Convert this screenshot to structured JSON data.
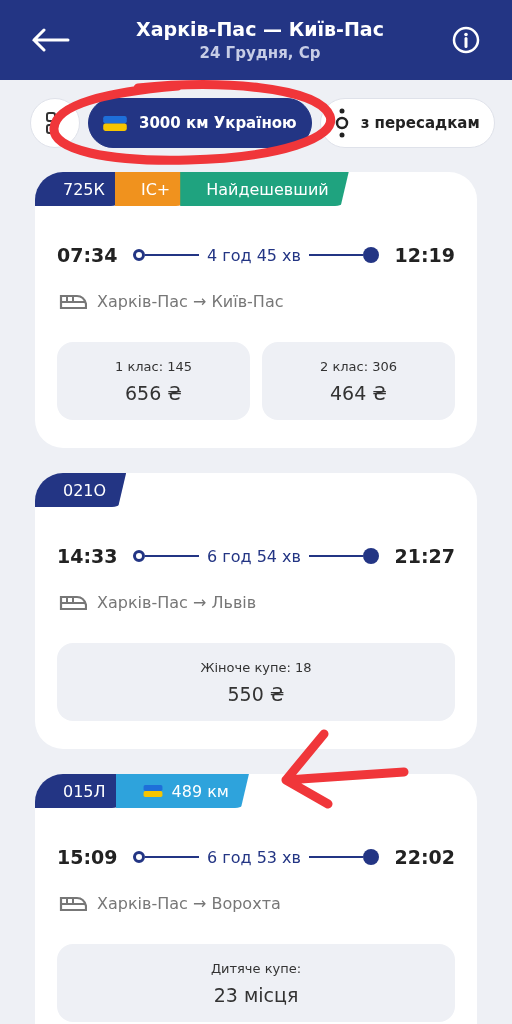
{
  "header": {
    "title": "Харків-Пас — Київ-Пас",
    "subtitle": "24 Грудня, Ср"
  },
  "chips": [
    {
      "kind": "icon",
      "selected": false
    },
    {
      "kind": "flag",
      "label": "3000 км Україною",
      "selected": true
    },
    {
      "kind": "transfer",
      "label": "з пересадкам",
      "selected": false
    }
  ],
  "trains": [
    {
      "tags": [
        {
          "kind": "plain",
          "label": "725К",
          "color": "#233584"
        },
        {
          "kind": "plain",
          "label": "IC+",
          "color": "#f0921e"
        },
        {
          "kind": "plain",
          "label": "Найдешевший",
          "color": "#1fa37f"
        }
      ],
      "departure": "07:34",
      "duration": "4 год 45 хв",
      "arrival": "12:19",
      "route": "Харків-Пас → Київ-Пас",
      "fares": [
        {
          "label": "1 клас: 145",
          "value": "656 ₴"
        },
        {
          "label": "2 клас: 306",
          "value": "464 ₴"
        }
      ]
    },
    {
      "tags": [
        {
          "kind": "plain",
          "label": "021О",
          "color": "#233584"
        }
      ],
      "departure": "14:33",
      "duration": "6 год 54 хв",
      "arrival": "21:27",
      "route": "Харків-Пас → Львів",
      "fares": [
        {
          "label": "Жіноче купе: 18",
          "value": "550 ₴"
        }
      ]
    },
    {
      "tags": [
        {
          "kind": "plain",
          "label": "015Л",
          "color": "#233584"
        },
        {
          "kind": "flag",
          "label": "489 км",
          "color": "#2ea3dc"
        }
      ],
      "departure": "15:09",
      "duration": "6 год 53 хв",
      "arrival": "22:02",
      "route": "Харків-Пас → Ворохта",
      "fares": [
        {
          "label": "Дитяче купе:",
          "value": "23 місця"
        }
      ]
    }
  ],
  "annotations": {
    "circle_drawn": true,
    "arrow_drawn": true
  }
}
